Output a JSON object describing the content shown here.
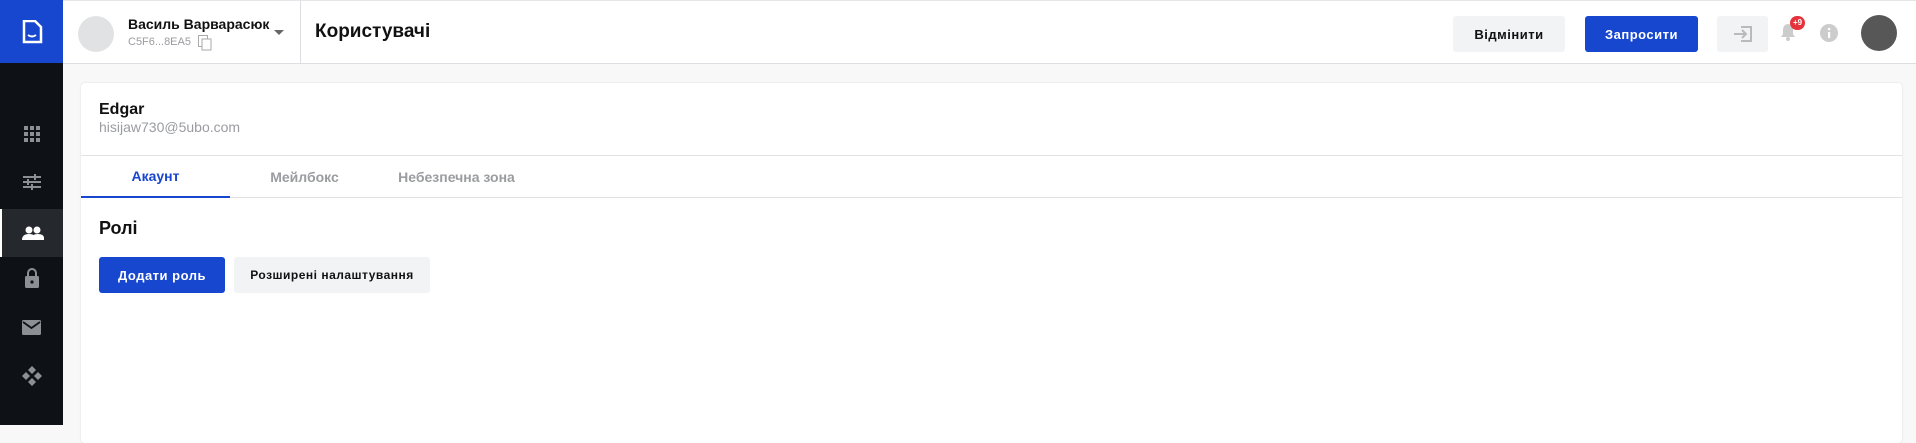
{
  "sidebar": {
    "items": [
      {
        "icon": "apps-grid-icon"
      },
      {
        "icon": "sliders-icon"
      },
      {
        "icon": "users-icon",
        "active": true
      },
      {
        "icon": "lock-icon"
      },
      {
        "icon": "mail-icon"
      },
      {
        "icon": "integrations-icon"
      }
    ]
  },
  "header": {
    "user_name": "Василь Варварасюк",
    "user_id": "C5F6...8EA5",
    "title": "Користувачі",
    "cancel_label": "Відмінити",
    "invite_label": "Запросити",
    "notification_badge": "+9"
  },
  "card": {
    "name": "Edgar",
    "email": "hisijaw730@5ubo.com",
    "tabs": [
      {
        "label": "Акаунт",
        "active": true
      },
      {
        "label": "Мейлбокс"
      },
      {
        "label": "Небезпечна зона"
      }
    ],
    "section_title": "Ролі",
    "add_role_label": "Додати роль",
    "advanced_label": "Розширені налаштування"
  },
  "colors": {
    "accent": "#1746cf",
    "sidebar": "#0e1116",
    "badge": "#e5333b"
  }
}
